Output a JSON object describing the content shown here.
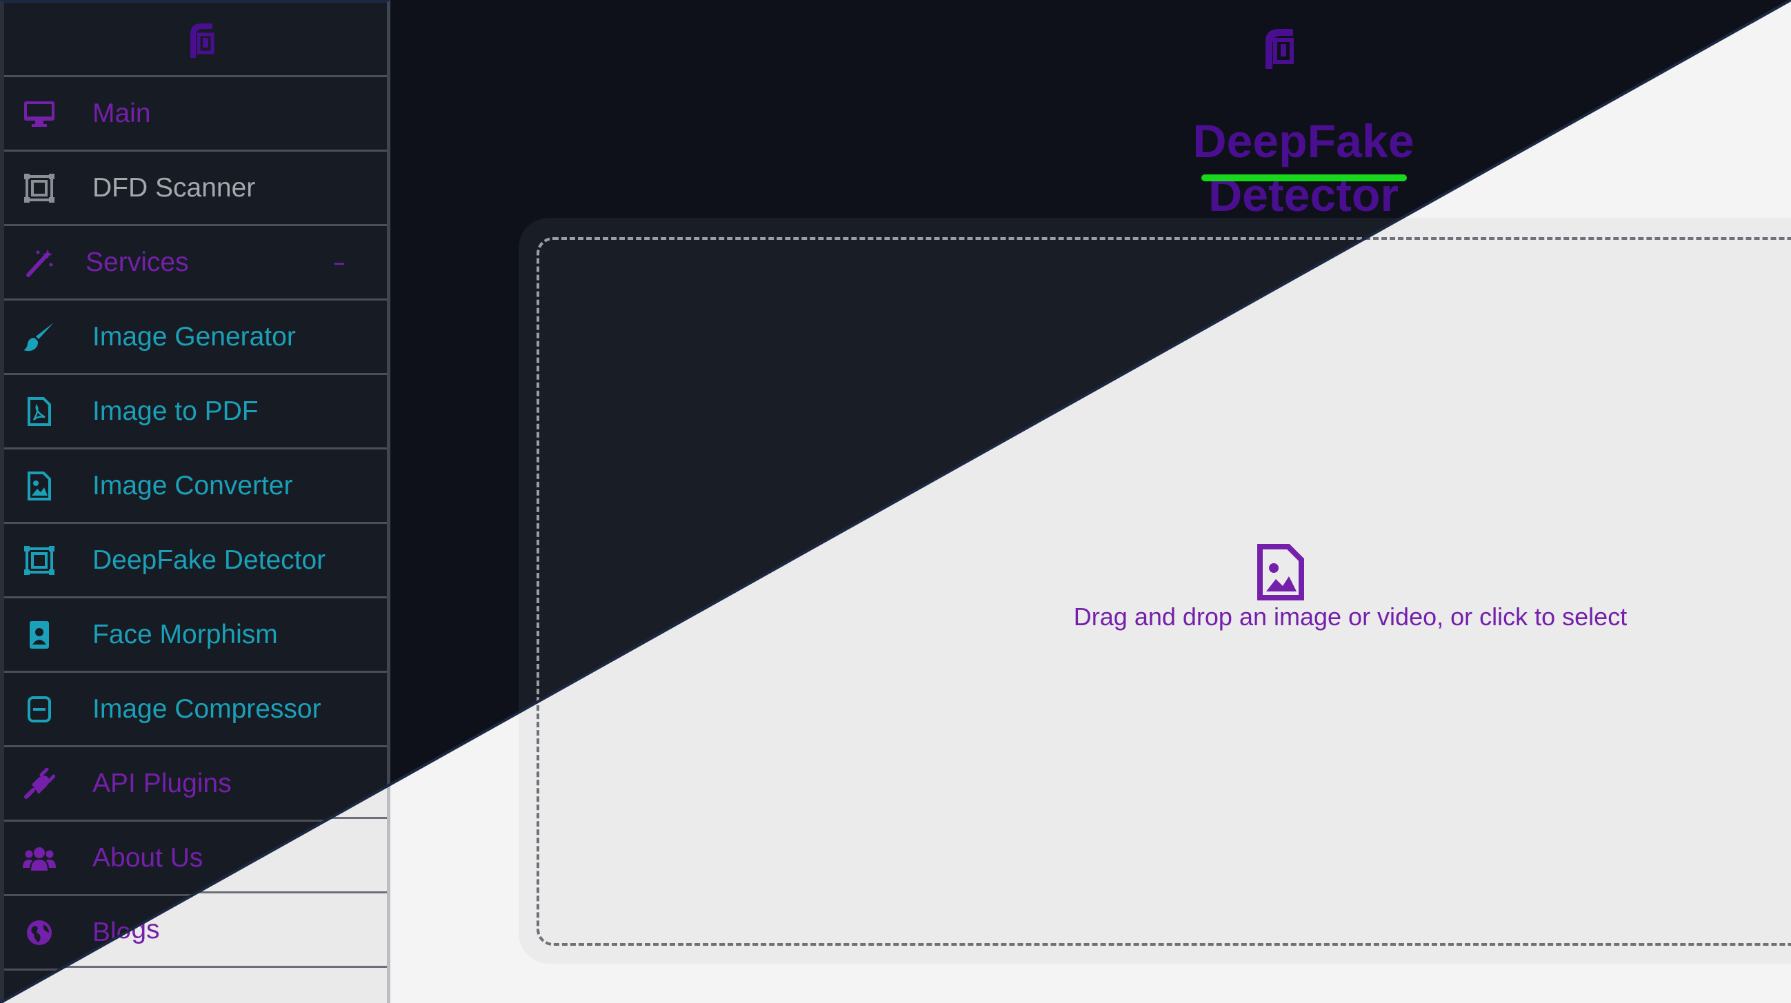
{
  "sidebar": {
    "items": [
      {
        "label": "Main",
        "icon": "monitor-icon",
        "tone": "purple"
      },
      {
        "label": "DFD Scanner",
        "icon": "scanner-icon",
        "tone": "gray"
      },
      {
        "label": "Services",
        "icon": "magic-wand-icon",
        "tone": "purple",
        "toggle": "–"
      },
      {
        "label": "Image Generator",
        "icon": "paintbrush-icon",
        "tone": "cyan"
      },
      {
        "label": "Image to PDF",
        "icon": "pdf-file-icon",
        "tone": "cyan"
      },
      {
        "label": "Image Converter",
        "icon": "image-file-icon",
        "tone": "cyan"
      },
      {
        "label": "DeepFake Detector",
        "icon": "scanner-icon",
        "tone": "cyan"
      },
      {
        "label": "Face Morphism",
        "icon": "portrait-icon",
        "tone": "cyan"
      },
      {
        "label": "Image Compressor",
        "icon": "compress-icon",
        "tone": "cyan"
      },
      {
        "label": "API Plugins",
        "icon": "plug-icon",
        "tone": "purple"
      },
      {
        "label": "About Us",
        "icon": "users-icon",
        "tone": "purple"
      },
      {
        "label": "Blogs",
        "icon": "globe-icon",
        "tone": "purple"
      }
    ]
  },
  "header": {
    "title": "DeepFake Detector"
  },
  "dropzone": {
    "text": "Drag and drop an image or video, or click to select",
    "icon": "image-file-icon"
  },
  "colors": {
    "purple": "#7420ab",
    "title": "#4a0f90",
    "underline": "#17d81b",
    "cyan": "#1aa0b8",
    "dark_bg": "#0e1119",
    "light_bg": "#f4f4f5"
  }
}
